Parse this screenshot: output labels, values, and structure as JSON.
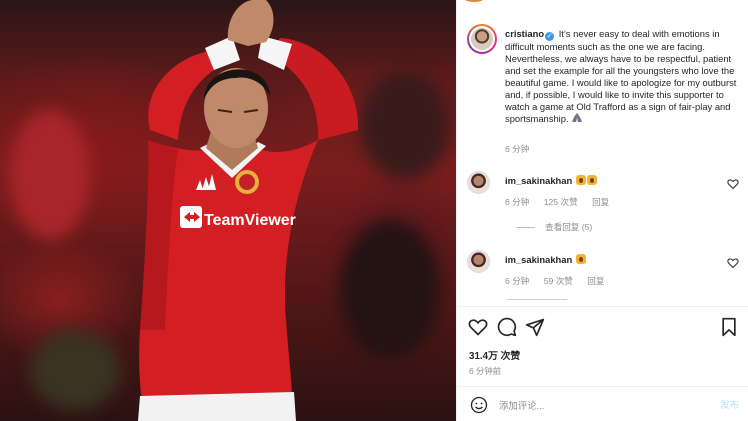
{
  "post": {
    "username": "cristiano",
    "caption": "It’s never easy to deal with emotions in difficult moments such as the one we are facing. Nevertheless, we always have to be respectful, patient and set the example for all the youngsters who love the beautiful game. I would like to apologize for my outburst and, if possible, I would like to invite this supporter to watch a game at Old Trafford as a sign of fair-play and sportsmanship.",
    "caption_emoji_icon": "folded-hands-icon",
    "caption_time": "6 分钟",
    "likes": "31.4万 次赞",
    "post_time": "6 分钟前"
  },
  "jersey": {
    "sponsor": "TeamViewer",
    "colors": {
      "shirt": "#d31f24",
      "shirt_dark": "#a4141a",
      "skin": "#c08a6a",
      "hair": "#1a1412",
      "crest_gold": "#e2b23a"
    }
  },
  "comments": [
    {
      "username": "im_sakinakhan",
      "emoji_icons": [
        "screaming-face-icon",
        "screaming-face-icon"
      ],
      "time": "6 分钟",
      "likes": "125 次赞",
      "reply": "回复",
      "view_replies": "查看回复 (5)"
    },
    {
      "username": "im_sakinakhan",
      "emoji_icons": [
        "screaming-face-icon"
      ],
      "time": "6 分钟",
      "likes": "59 次赞",
      "reply": "回复"
    }
  ],
  "add_comment": {
    "placeholder": "添加评论...",
    "post_label": "发布"
  },
  "icons": {
    "like": "heart-icon",
    "comment": "comment-icon",
    "share": "share-icon",
    "save": "bookmark-icon",
    "emoji": "smile-icon"
  },
  "colors": {
    "accent": "#3897f0",
    "muted": "#8e8e8e",
    "text": "#262626",
    "post_disabled": "#b2dffc"
  }
}
